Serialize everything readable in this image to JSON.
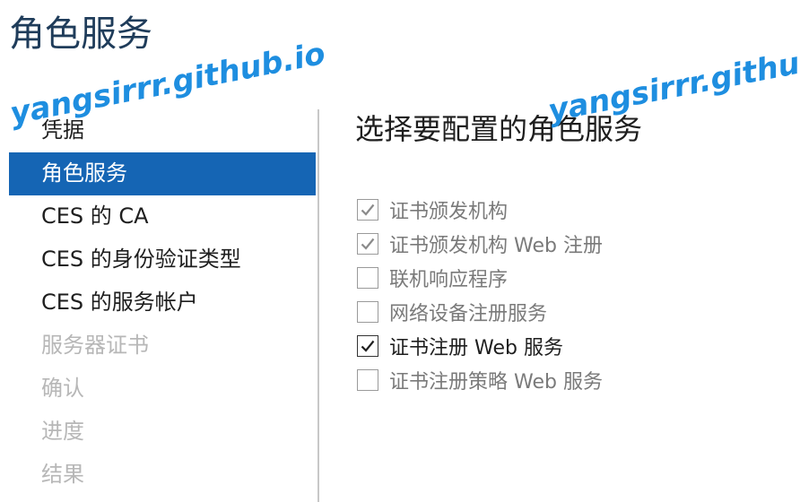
{
  "page": {
    "title": "角色服务"
  },
  "watermark": {
    "text": "yangsirrr.github.io",
    "text2": "yangsirrr.github.i"
  },
  "nav": {
    "items": [
      {
        "label": "凭据",
        "state": "normal"
      },
      {
        "label": "角色服务",
        "state": "active"
      },
      {
        "label": "CES 的 CA",
        "state": "normal"
      },
      {
        "label": "CES 的身份验证类型",
        "state": "normal"
      },
      {
        "label": "CES 的服务帐户",
        "state": "normal"
      },
      {
        "label": "服务器证书",
        "state": "disabled"
      },
      {
        "label": "确认",
        "state": "disabled"
      },
      {
        "label": "进度",
        "state": "disabled"
      },
      {
        "label": "结果",
        "state": "disabled"
      }
    ]
  },
  "main": {
    "heading": "选择要配置的角色服务",
    "roles": [
      {
        "label": "证书颁发机构",
        "checked": true,
        "enabled": false
      },
      {
        "label": "证书颁发机构 Web 注册",
        "checked": true,
        "enabled": false
      },
      {
        "label": "联机响应程序",
        "checked": false,
        "enabled": false
      },
      {
        "label": "网络设备注册服务",
        "checked": false,
        "enabled": false
      },
      {
        "label": "证书注册 Web 服务",
        "checked": true,
        "enabled": true
      },
      {
        "label": "证书注册策略 Web 服务",
        "checked": false,
        "enabled": false
      }
    ]
  },
  "colors": {
    "title": "#1f3c5a",
    "active_nav_bg": "#1565b4",
    "disabled_text": "#b7b7b7",
    "watermark": "#1e8ee0"
  }
}
